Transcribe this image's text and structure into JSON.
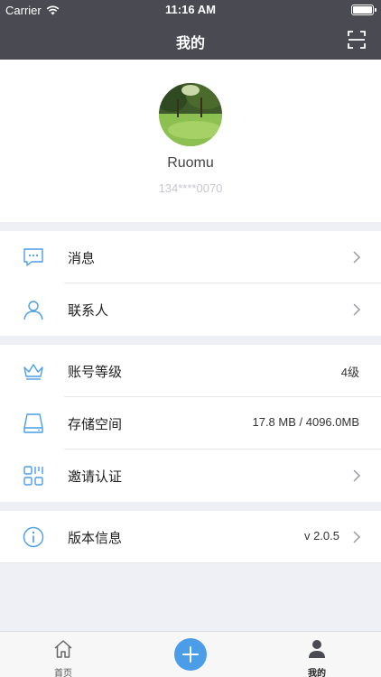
{
  "status_bar": {
    "carrier": "Carrier",
    "time": "11:16 AM"
  },
  "nav": {
    "title": "我的",
    "scan_icon": "scan-icon"
  },
  "profile": {
    "name": "Ruomu",
    "phone": "134****0070"
  },
  "groups": [
    {
      "rows": [
        {
          "icon": "message-icon",
          "label": "消息",
          "value": "",
          "chevron": true
        },
        {
          "icon": "contact-icon",
          "label": "联系人",
          "value": "",
          "chevron": true
        }
      ]
    },
    {
      "rows": [
        {
          "icon": "crown-icon",
          "label": "账号等级",
          "value": "4级",
          "chevron": false
        },
        {
          "icon": "storage-icon",
          "label": "存储空间",
          "value": "17.8 MB / 4096.0MB",
          "chevron": false
        },
        {
          "icon": "qrcode-icon",
          "label": "邀请认证",
          "value": "",
          "chevron": true
        }
      ]
    },
    {
      "rows": [
        {
          "icon": "info-icon",
          "label": "版本信息",
          "value": "v 2.0.5",
          "chevron": true
        }
      ]
    }
  ],
  "tab_bar": {
    "home": "首页",
    "mine": "我的"
  },
  "colors": {
    "nav_bg": "#4a4b52",
    "icon_blue": "#4a9de6",
    "page_bg": "#eef0f5"
  }
}
